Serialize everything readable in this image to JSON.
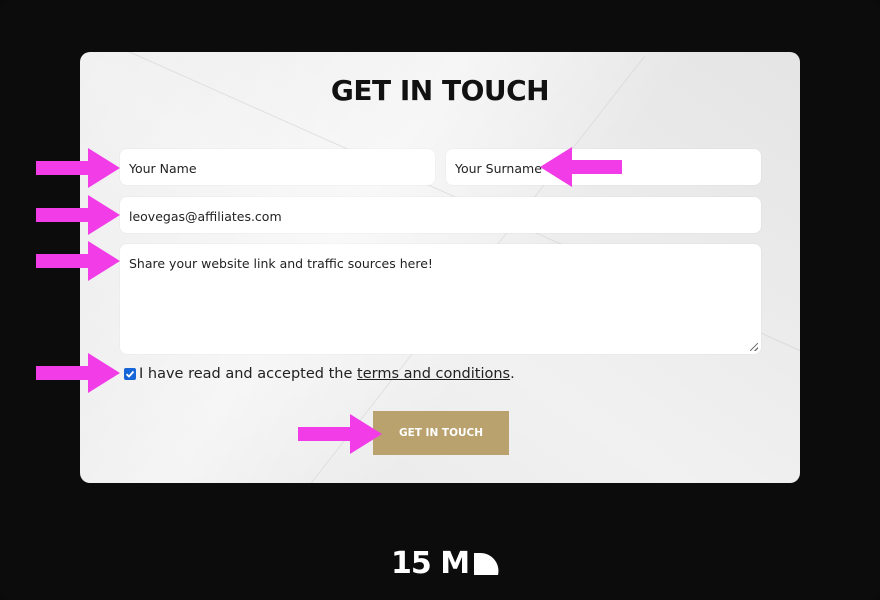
{
  "form": {
    "title": "GET IN TOUCH",
    "name_placeholder": "Your Name",
    "surname_placeholder": "Your Surname",
    "email_value": "leovegas@affiliates.com",
    "message_placeholder": "Share your  website link and traffic sources here!",
    "terms_checked": true,
    "terms_prefix": "I have read and accepted the ",
    "terms_link": "terms and conditions",
    "terms_suffix": ".",
    "submit_label": "GET IN TOUCH"
  },
  "colors": {
    "background": "#0c0c0c",
    "card": "#f1f1f1",
    "arrow": "#f13ce8",
    "submit": "#b9a26e",
    "checkbox": "#1565d8"
  },
  "icons": [
    "arrow-right-icon",
    "arrow-left-icon",
    "checkmark-icon",
    "resize-grip-icon"
  ],
  "logo": {
    "text": "15 M"
  }
}
